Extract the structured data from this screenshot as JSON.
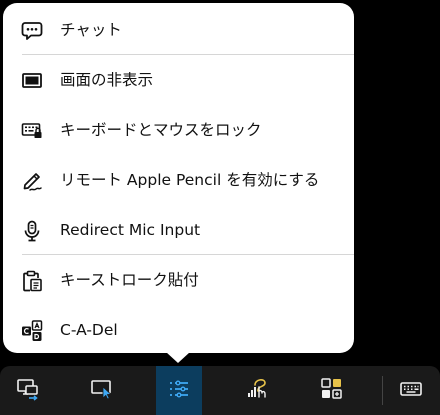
{
  "menu": {
    "items": [
      {
        "label": "チャット",
        "icon": "chat-bubble-icon"
      },
      {
        "label": "画面の非表示",
        "icon": "screen-blank-icon"
      },
      {
        "label": "キーボードとマウスをロック",
        "icon": "lock-keyboard-mouse-icon"
      },
      {
        "label": "リモート Apple Pencil を有効にする",
        "icon": "pencil-icon"
      },
      {
        "label": "Redirect Mic Input",
        "icon": "microphone-icon"
      },
      {
        "label": "キーストローク貼付",
        "icon": "clipboard-paste-icon"
      },
      {
        "label": "C-A-Del",
        "icon": "ctrl-alt-del-icon"
      }
    ]
  },
  "toolbar": {
    "buttons": [
      {
        "icon": "switch-computer-icon",
        "active": false
      },
      {
        "icon": "screen-cursor-icon",
        "active": false
      },
      {
        "icon": "actions-menu-icon",
        "active": true
      },
      {
        "icon": "gesture-signal-icon",
        "active": false
      },
      {
        "icon": "apps-grid-icon",
        "active": false
      },
      {
        "icon": "keyboard-icon",
        "active": false
      }
    ]
  },
  "colors": {
    "accent": "#3fa9f5",
    "active_bg": "#0c3d5e",
    "toolbar_bg": "#1a1a1a",
    "menu_bg": "#ffffff"
  }
}
